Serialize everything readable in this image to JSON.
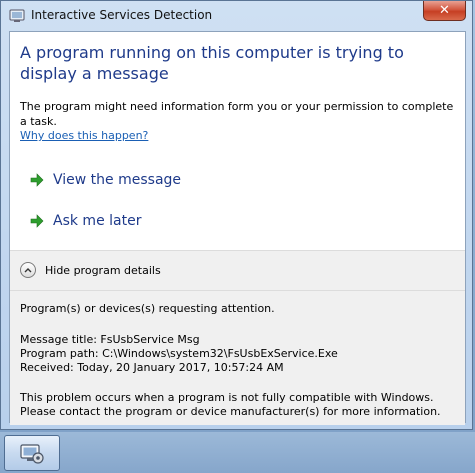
{
  "window": {
    "title": "Interactive Services Detection",
    "close_label": "✕"
  },
  "main": {
    "headline": "A program running on this computer is trying to display a message",
    "description": "The program might need information form you or your permission to complete a task.",
    "why_link": "Why does this happen?",
    "commands": [
      {
        "label": "View the message",
        "icon": "green-arrow-icon"
      },
      {
        "label": "Ask me later",
        "icon": "green-arrow-icon"
      }
    ]
  },
  "details": {
    "toggle_label": "Hide program details",
    "attention_text": "Program(s) or devices(s) requesting attention.",
    "message_title": "Message title:  FsUsbService Msg",
    "program_path": "Program path:  C:\\Windows\\system32\\FsUsbExService.Exe",
    "received": "Received:  Today, 20 January 2017, 10:57:24 AM",
    "problem_line1": "This problem occurs when a program is not fully compatible with Windows.",
    "problem_line2": "Please contact the program or device manufacturer(s) for more information."
  },
  "taskbar": {
    "app_icon": "interactive-services-icon"
  },
  "colors": {
    "accent_blue": "#1e3a8a",
    "link_blue": "#1a5fb4",
    "arrow_green": "#2e9e2e",
    "close_red": "#c63f23"
  }
}
